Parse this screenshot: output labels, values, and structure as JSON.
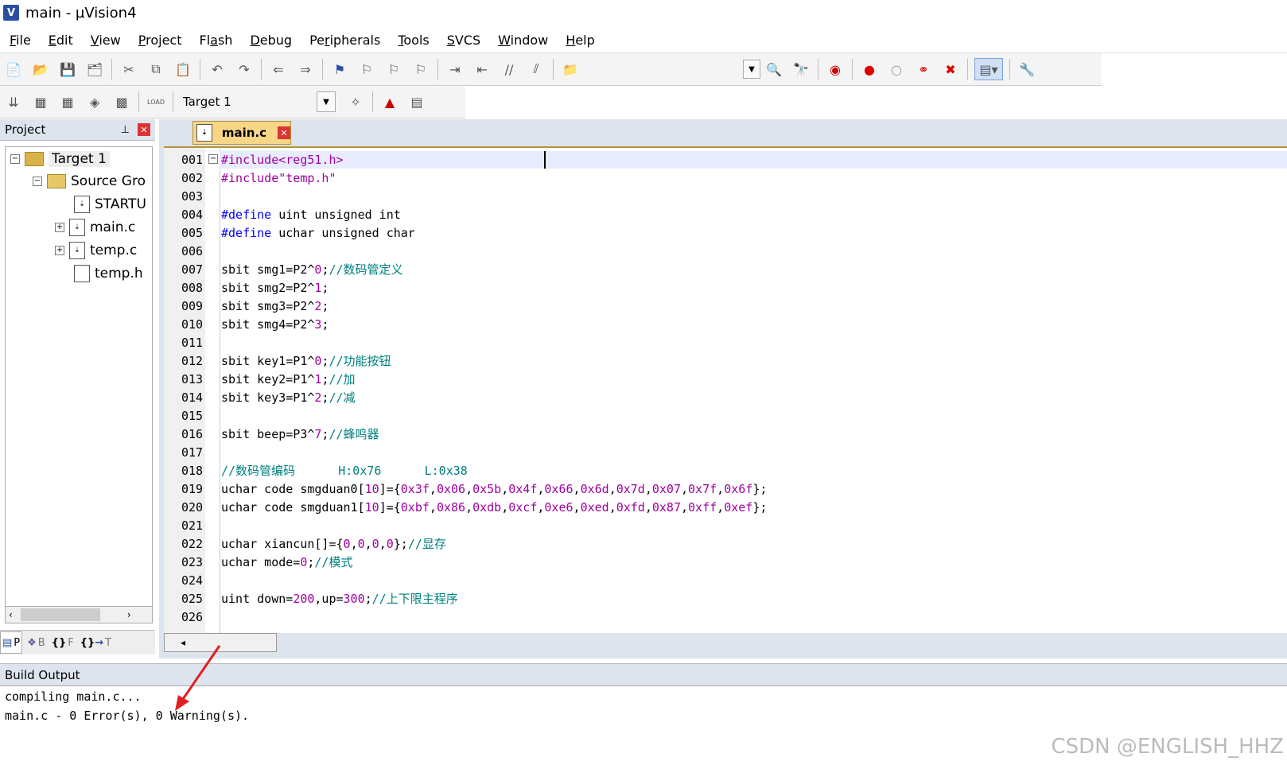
{
  "window": {
    "app_icon": "V",
    "title": "main  - µVision4"
  },
  "menu": [
    {
      "pre": "",
      "u": "F",
      "post": "ile"
    },
    {
      "pre": "",
      "u": "E",
      "post": "dit"
    },
    {
      "pre": "",
      "u": "V",
      "post": "iew"
    },
    {
      "pre": "",
      "u": "P",
      "post": "roject"
    },
    {
      "pre": "Fl",
      "u": "a",
      "post": "sh"
    },
    {
      "pre": "",
      "u": "D",
      "post": "ebug"
    },
    {
      "pre": "Pe",
      "u": "r",
      "post": "ipherals"
    },
    {
      "pre": "",
      "u": "T",
      "post": "ools"
    },
    {
      "pre": "",
      "u": "S",
      "post": "VCS"
    },
    {
      "pre": "",
      "u": "W",
      "post": "indow"
    },
    {
      "pre": "",
      "u": "H",
      "post": "elp"
    }
  ],
  "toolbar2": {
    "target": "Target 1",
    "load_label": "LOAD"
  },
  "project_panel": {
    "title": "Project",
    "pin_icon": "pin-icon",
    "tree": {
      "target": "Target 1",
      "group": "Source Gro",
      "files": [
        "STARTU",
        "main.c",
        "temp.c",
        "temp.h"
      ]
    },
    "tabs": [
      "P",
      "B",
      "F",
      "T"
    ]
  },
  "editor": {
    "tab_label": "main.c",
    "line_numbers": [
      "001",
      "002",
      "003",
      "004",
      "005",
      "006",
      "007",
      "008",
      "009",
      "010",
      "011",
      "012",
      "013",
      "014",
      "015",
      "016",
      "017",
      "018",
      "019",
      "020",
      "021",
      "022",
      "023",
      "024",
      "025",
      "026"
    ]
  },
  "build_output": {
    "title": "Build Output",
    "lines": [
      "compiling main.c...",
      "main.c - 0 Error(s), 0 Warning(s)."
    ]
  },
  "watermark": "CSDN @ENGLISH_HHZ"
}
